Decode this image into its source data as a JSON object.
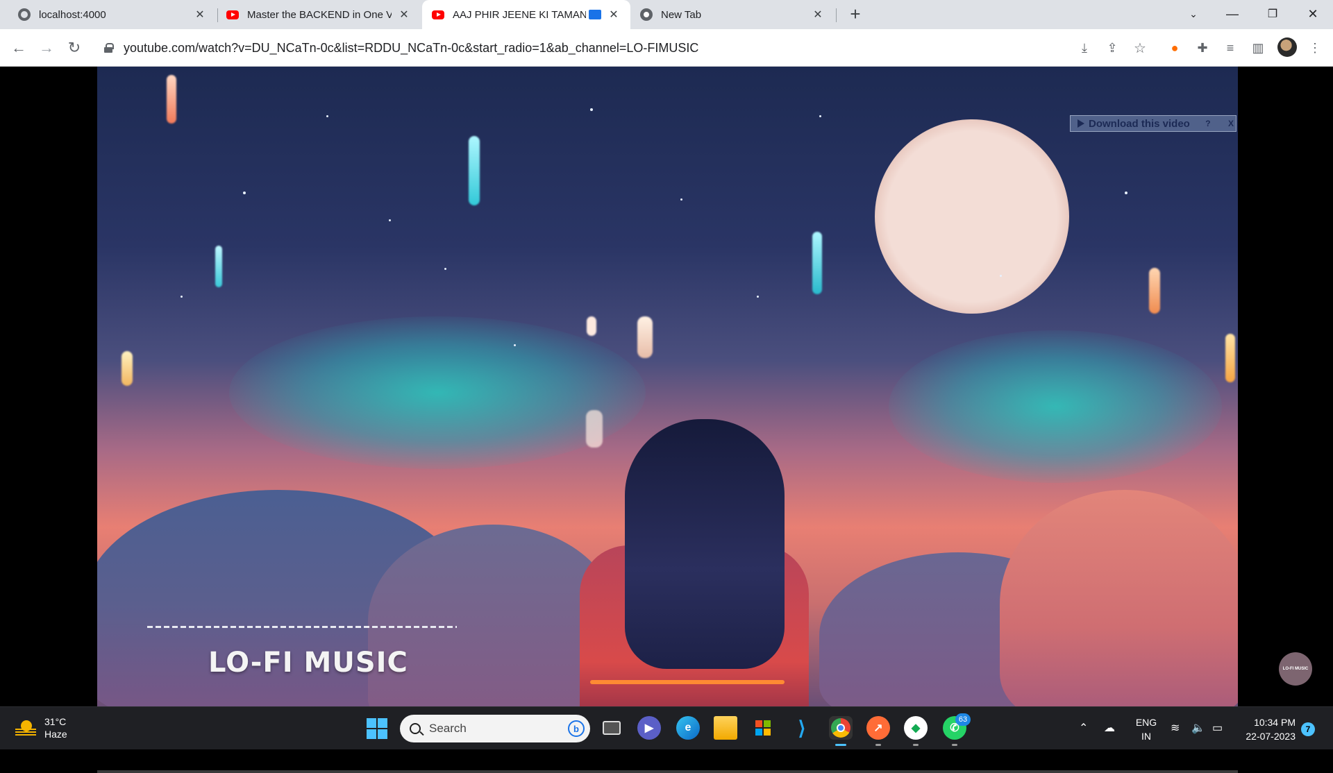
{
  "browser": {
    "tabs": [
      {
        "title": "localhost:4000",
        "icon": "globe-icon"
      },
      {
        "title": "Master the BACKEND in One Vide",
        "icon": "youtube-icon"
      },
      {
        "title": "AAJ PHIR JEENE KI TAMANN",
        "icon": "youtube-icon"
      },
      {
        "title": "New Tab",
        "icon": "chrome-icon"
      }
    ],
    "active_tab": 2,
    "url": "youtube.com/watch?v=DU_NCaTn-0c&list=RDDU_NCaTn-0c&start_radio=1&ab_channel=LO-FIMUSIC"
  },
  "video": {
    "overlay_title": "LO-FI MUSIC",
    "download_label": "Download this video",
    "download_help": "?",
    "download_close": "X",
    "channel_badge": "LO-FI MUSIC"
  },
  "taskbar": {
    "weather": {
      "temp": "31°C",
      "condition": "Haze"
    },
    "search_label": "Search",
    "whatsapp_badge": "63",
    "language": {
      "line1": "ENG",
      "line2": "IN"
    },
    "clock": {
      "time": "10:34 PM",
      "date": "22-07-2023"
    },
    "notifications": "7"
  }
}
